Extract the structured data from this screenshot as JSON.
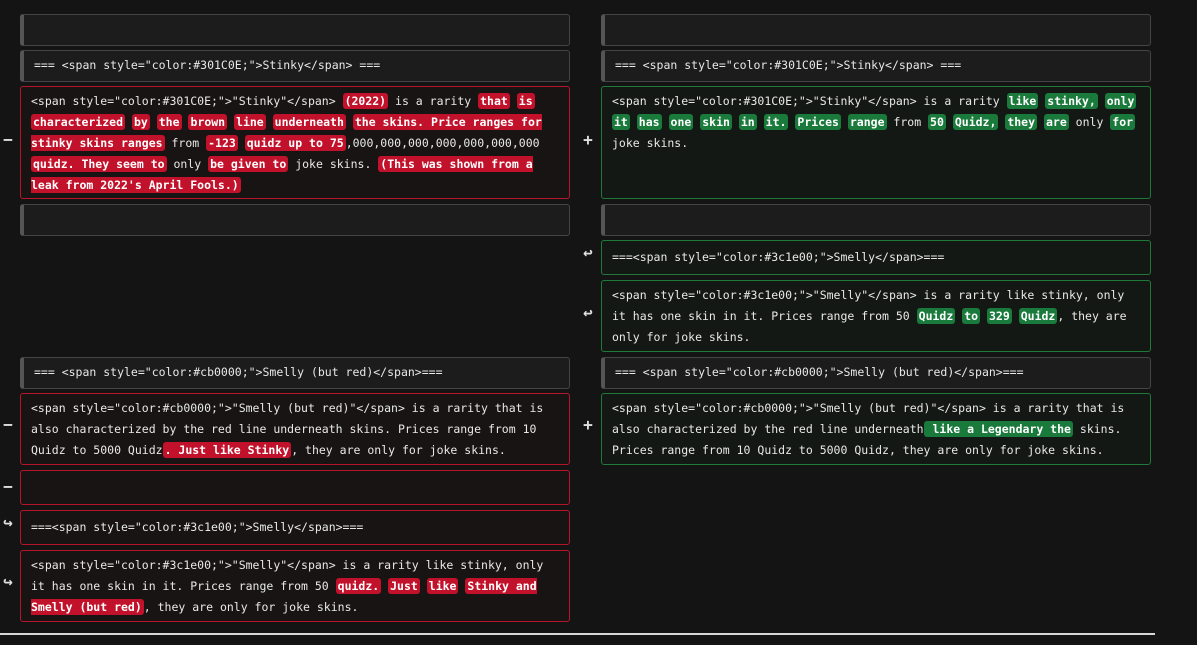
{
  "markers": {
    "minus": "−",
    "plus": "+",
    "moved": "↩",
    "moved_left": "↪"
  },
  "left": {
    "row1_empty": "",
    "header_stinky": "=== <span style=\"color:#301C0E;\">Stinky</span> ===",
    "stinky_body": [
      {
        "t": "<span style=\"color:#301C0E;\">\"Stinky\"</span> ",
        "h": false
      },
      {
        "t": "(2022)",
        "h": true
      },
      {
        "t": " is a rarity ",
        "h": false
      },
      {
        "t": "that",
        "h": true
      },
      {
        "t": " ",
        "h": false
      },
      {
        "t": "is",
        "h": true
      },
      {
        "t": " ",
        "h": false
      },
      {
        "t": "characterized",
        "h": true
      },
      {
        "t": " ",
        "h": false
      },
      {
        "t": "by",
        "h": true
      },
      {
        "t": " ",
        "h": false
      },
      {
        "t": "the",
        "h": true
      },
      {
        "t": " ",
        "h": false
      },
      {
        "t": "brown",
        "h": true
      },
      {
        "t": " ",
        "h": false
      },
      {
        "t": "line",
        "h": true
      },
      {
        "t": " ",
        "h": false
      },
      {
        "t": "underneath",
        "h": true
      },
      {
        "t": " ",
        "h": false
      },
      {
        "t": "the skins. Price ranges for stinky skins ranges",
        "h": true
      },
      {
        "t": " from ",
        "h": false
      },
      {
        "t": "-123",
        "h": true
      },
      {
        "t": " ",
        "h": false
      },
      {
        "t": "quidz up to 75",
        "h": true
      },
      {
        "t": ",000,000,000,000,000,000,000 ",
        "h": false
      },
      {
        "t": "quidz. They seem to",
        "h": true
      },
      {
        "t": " only ",
        "h": false
      },
      {
        "t": "be given to",
        "h": true
      },
      {
        "t": " joke skins. ",
        "h": false
      },
      {
        "t": "(This was shown from a leak from 2022's April Fools.)",
        "h": true
      }
    ],
    "empty2": "",
    "header_smelly_red": "=== <span style=\"color:#cb0000;\">Smelly (but red)</span>===",
    "smelly_red_body": [
      {
        "t": "<span style=\"color:#cb0000;\">\"Smelly (but red)\"</span> is a rarity that is also characterized by the red line underneath skins. Prices range from 10 Quidz to 5000 Quidz",
        "h": false
      },
      {
        "t": ". Just like Stinky",
        "h": true
      },
      {
        "t": ", they are only for joke skins.",
        "h": false
      }
    ],
    "empty3": "",
    "header_smelly": "===<span style=\"color:#3c1e00;\">Smelly</span>===",
    "smelly_body": [
      {
        "t": "<span style=\"color:#3c1e00;\">\"Smelly\"</span> is a rarity like stinky, only it has one skin in it. Prices range from 50 ",
        "h": false
      },
      {
        "t": "quidz.",
        "h": true
      },
      {
        "t": " ",
        "h": false
      },
      {
        "t": "Just",
        "h": true
      },
      {
        "t": " ",
        "h": false
      },
      {
        "t": "like",
        "h": true
      },
      {
        "t": " ",
        "h": false
      },
      {
        "t": "Stinky and Smelly (but red)",
        "h": true
      },
      {
        "t": ", they are only for joke skins.",
        "h": false
      }
    ]
  },
  "right": {
    "row1_empty": "",
    "header_stinky": "=== <span style=\"color:#301C0E;\">Stinky</span> ===",
    "stinky_body": [
      {
        "t": "<span style=\"color:#301C0E;\">\"Stinky\"</span> is a rarity ",
        "h": false
      },
      {
        "t": "like",
        "h": true
      },
      {
        "t": " ",
        "h": false
      },
      {
        "t": "stinky,",
        "h": true
      },
      {
        "t": " ",
        "h": false
      },
      {
        "t": "only",
        "h": true
      },
      {
        "t": " ",
        "h": false
      },
      {
        "t": "it",
        "h": true
      },
      {
        "t": " ",
        "h": false
      },
      {
        "t": "has",
        "h": true
      },
      {
        "t": " ",
        "h": false
      },
      {
        "t": "one",
        "h": true
      },
      {
        "t": " ",
        "h": false
      },
      {
        "t": "skin",
        "h": true
      },
      {
        "t": " ",
        "h": false
      },
      {
        "t": "in",
        "h": true
      },
      {
        "t": " ",
        "h": false
      },
      {
        "t": "it.",
        "h": true
      },
      {
        "t": " ",
        "h": false
      },
      {
        "t": "Prices",
        "h": true
      },
      {
        "t": " ",
        "h": false
      },
      {
        "t": "range",
        "h": true
      },
      {
        "t": " from ",
        "h": false
      },
      {
        "t": "50",
        "h": true
      },
      {
        "t": " ",
        "h": false
      },
      {
        "t": "Quidz,",
        "h": true
      },
      {
        "t": " ",
        "h": false
      },
      {
        "t": "they",
        "h": true
      },
      {
        "t": " ",
        "h": false
      },
      {
        "t": "are",
        "h": true
      },
      {
        "t": " only ",
        "h": false
      },
      {
        "t": "for",
        "h": true
      },
      {
        "t": " joke skins.",
        "h": false
      }
    ],
    "empty2": "",
    "header_smelly": "===<span style=\"color:#3c1e00;\">Smelly</span>===",
    "smelly_body": [
      {
        "t": "<span style=\"color:#3c1e00;\">\"Smelly\"</span> is a rarity like stinky, only it has one skin in it. Prices range from 50 ",
        "h": false
      },
      {
        "t": "Quidz",
        "h": true
      },
      {
        "t": " ",
        "h": false
      },
      {
        "t": "to",
        "h": true
      },
      {
        "t": " ",
        "h": false
      },
      {
        "t": "329",
        "h": true
      },
      {
        "t": " ",
        "h": false
      },
      {
        "t": "Quidz",
        "h": true
      },
      {
        "t": ", they are only for joke skins.",
        "h": false
      }
    ],
    "header_smelly_red": "=== <span style=\"color:#cb0000;\">Smelly (but red)</span>===",
    "smelly_red_body": [
      {
        "t": "<span style=\"color:#cb0000;\">\"Smelly (but red)\"</span> is a rarity that is also characterized by the red line underneath",
        "h": false
      },
      {
        "t": " like a Legendary the",
        "h": true
      },
      {
        "t": " skins. Prices range from 10 Quidz to 5000 Quidz, they are only for joke skins.",
        "h": false
      }
    ]
  }
}
